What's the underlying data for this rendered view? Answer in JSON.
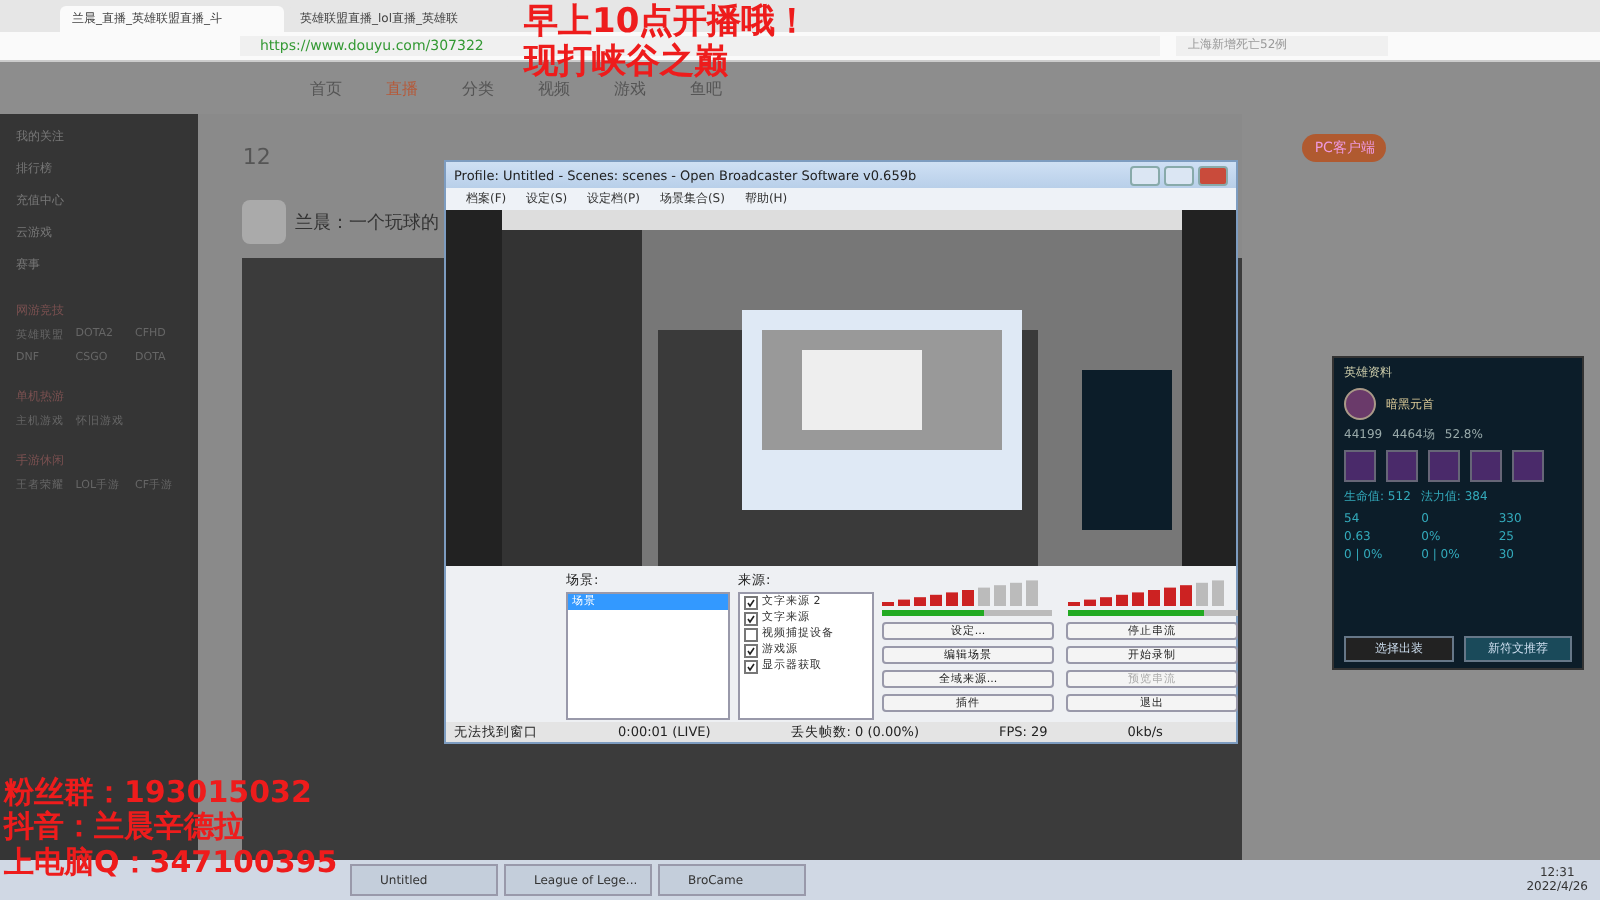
{
  "browser": {
    "tabs": [
      {
        "label": "兰晨_直播_英雄联盟直播_斗",
        "selected": true
      },
      {
        "label": "英雄联盟直播_lol直播_英雄联",
        "selected": false
      }
    ],
    "url": "https://www.douyu.com/307322",
    "news": "上海新增死亡52例"
  },
  "site": {
    "nav": [
      {
        "label": "首页",
        "selected": false
      },
      {
        "label": "直播",
        "selected": true
      },
      {
        "label": "分类",
        "selected": false
      },
      {
        "label": "视频",
        "selected": false
      },
      {
        "label": "游戏",
        "selected": false
      },
      {
        "label": "鱼吧",
        "selected": false
      }
    ],
    "score": "12",
    "pc_client": "PC客户端",
    "streamer_title": "兰晨：一个玩球的",
    "sidebar": [
      {
        "label": "我的关注"
      },
      {
        "label": "排行榜"
      },
      {
        "label": "充值中心"
      },
      {
        "label": "云游戏"
      },
      {
        "label": "赛事"
      }
    ],
    "categories": [
      {
        "title": "网游竞技",
        "items": [
          "英雄联盟",
          "DOTA2",
          "CFHD",
          "DNF",
          "CSGO",
          "DOTA"
        ]
      },
      {
        "title": "单机热游",
        "items": [
          "主机游戏",
          "怀旧游戏"
        ]
      },
      {
        "title": "手游休闲",
        "items": [
          "王者荣耀",
          "LOL手游",
          "CF手游"
        ]
      }
    ]
  },
  "overlay": {
    "top": [
      "早上10点开播哦！",
      "现打峡谷之巅"
    ],
    "bottom": [
      "粉丝群：193015032",
      "抖音：兰晨辛德拉",
      "上电脑Q：347100395"
    ]
  },
  "obs": {
    "title": "Profile: Untitled - Scenes: scenes - Open Broadcaster Software v0.659b",
    "menu": [
      "档案(F)",
      "设定(S)",
      "设定档(P)",
      "场景集合(S)",
      "帮助(H)"
    ],
    "scenes_label": "场景:",
    "scenes": [
      {
        "label": "场景",
        "selected": true
      }
    ],
    "sources_label": "来源:",
    "sources": [
      {
        "label": "文字来源 2",
        "checked": true
      },
      {
        "label": "文字来源",
        "checked": true
      },
      {
        "label": "视频捕捉设备",
        "checked": false
      },
      {
        "label": "游戏源",
        "checked": true
      },
      {
        "label": "显示器获取",
        "checked": true
      }
    ],
    "mic": {
      "level": 0.6
    },
    "speaker": {
      "level": 0.8
    },
    "buttons": [
      {
        "label": "设定...",
        "disabled": false
      },
      {
        "label": "停止串流",
        "disabled": false
      },
      {
        "label": "编辑场景",
        "disabled": false
      },
      {
        "label": "开始录制",
        "disabled": false
      },
      {
        "label": "全域来源...",
        "disabled": false
      },
      {
        "label": "预览串流",
        "disabled": true
      },
      {
        "label": "插件",
        "disabled": false
      },
      {
        "label": "退出",
        "disabled": false
      }
    ],
    "status": [
      "无法找到窗口",
      "0:00:01 (LIVE)",
      "丢失帧数: 0 (0.00%)",
      "FPS: 29",
      "0kb/s"
    ]
  },
  "hero_panel": {
    "title": "英雄资料",
    "name": "暗黑元首",
    "stats": [
      "44199",
      "4464场",
      "52.8%"
    ],
    "hp": "生命值: 512",
    "mp": "法力值: 384",
    "attrs": [
      "54",
      "0",
      "330",
      "0.63",
      "0%",
      "25",
      "0 | 0%",
      "0 | 0%",
      "30"
    ],
    "buttons": [
      "选择出装",
      "新符文推荐"
    ]
  },
  "taskbar": {
    "apps": [
      {
        "label": "Untitled",
        "selected": false
      },
      {
        "label": "League of Lege...",
        "selected": false
      },
      {
        "label": "BroCame",
        "selected": false
      }
    ],
    "time": "12:31",
    "date": "2022/4/26"
  }
}
